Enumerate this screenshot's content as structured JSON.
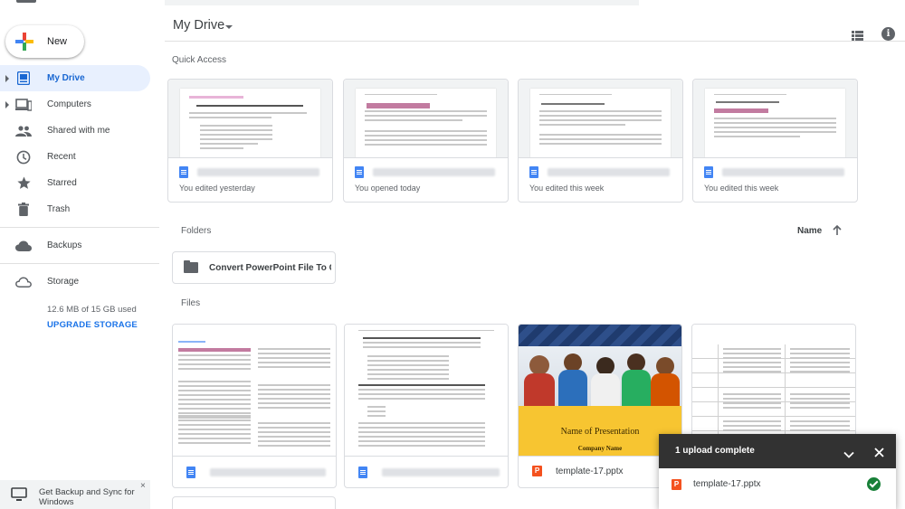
{
  "sidebar": {
    "new_label": "New",
    "items": [
      {
        "label": "My Drive",
        "icon": "drive-icon",
        "active": true
      },
      {
        "label": "Computers",
        "icon": "computer-icon"
      },
      {
        "label": "Shared with me",
        "icon": "people-icon"
      },
      {
        "label": "Recent",
        "icon": "clock-icon"
      },
      {
        "label": "Starred",
        "icon": "star-icon"
      },
      {
        "label": "Trash",
        "icon": "trash-icon"
      },
      {
        "label": "Backups",
        "icon": "cloud-icon"
      },
      {
        "label": "Storage",
        "icon": "cloud-outline-icon"
      }
    ],
    "storage_used": "12.6 MB of 15 GB used",
    "upgrade_label": "UPGRADE STORAGE",
    "backup_prompt": "Get Backup and Sync for Windows",
    "backup_close": "×"
  },
  "header": {
    "title": "My Drive"
  },
  "quick_access": {
    "label": "Quick Access",
    "cards": [
      {
        "subtitle": "You edited yesterday"
      },
      {
        "subtitle": "You opened today"
      },
      {
        "subtitle": "You edited this week"
      },
      {
        "subtitle": "You edited this week"
      }
    ]
  },
  "folders": {
    "label": "Folders",
    "sort_label": "Name",
    "items": [
      {
        "name": "Convert PowerPoint File To G..."
      }
    ]
  },
  "files": {
    "label": "Files",
    "items": [
      {
        "type": "doc"
      },
      {
        "type": "doc"
      },
      {
        "type": "pptx",
        "name": "template-17.pptx",
        "slide_title": "Name of Presentation",
        "slide_subtitle": "Company Name"
      },
      {
        "type": "doc"
      }
    ]
  },
  "upload_panel": {
    "title": "1 upload complete",
    "file_name": "template-17.pptx",
    "ppt_letter": "P"
  },
  "colors": {
    "accent": "#1a73e8",
    "active_bg": "#e8f0fe",
    "doc_blue": "#4285f4",
    "ppt_orange": "#f4511e",
    "success_green": "#188038"
  }
}
